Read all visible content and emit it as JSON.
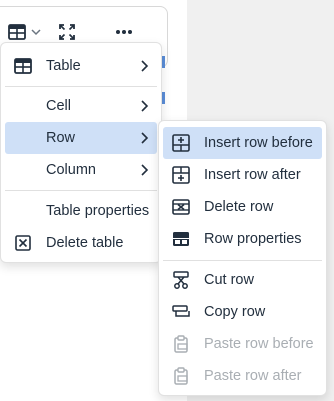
{
  "toolbar": {
    "table_icon": "table-icon",
    "dropdown_icon": "chevron-down-icon",
    "fullscreen_icon": "fullscreen-icon",
    "more_icon": "more-horizontal-icon"
  },
  "main_menu": {
    "items": [
      {
        "label": "Table",
        "icon": "table-icon",
        "submenu": true
      },
      {
        "label": "Cell",
        "icon": "",
        "submenu": true
      },
      {
        "label": "Row",
        "icon": "",
        "submenu": true,
        "active": true
      },
      {
        "label": "Column",
        "icon": "",
        "submenu": true
      },
      {
        "label": "Table properties",
        "icon": ""
      },
      {
        "label": "Delete table",
        "icon": "delete-table-icon"
      }
    ]
  },
  "row_submenu": {
    "items": [
      {
        "label": "Insert row before",
        "icon": "insert-row-before-icon",
        "active": true
      },
      {
        "label": "Insert row after",
        "icon": "insert-row-after-icon"
      },
      {
        "label": "Delete row",
        "icon": "delete-row-icon"
      },
      {
        "label": "Row properties",
        "icon": "row-properties-icon"
      },
      {
        "label": "Cut row",
        "icon": "cut-icon"
      },
      {
        "label": "Copy row",
        "icon": "copy-row-icon"
      },
      {
        "label": "Paste row before",
        "icon": "paste-icon",
        "disabled": true
      },
      {
        "label": "Paste row after",
        "icon": "paste-icon",
        "disabled": true
      }
    ]
  },
  "colors": {
    "highlight": "#cfe0f7",
    "text": "#222f3e",
    "disabled_text": "#a9aeb3",
    "accent_blue": "#5b8ed8"
  }
}
